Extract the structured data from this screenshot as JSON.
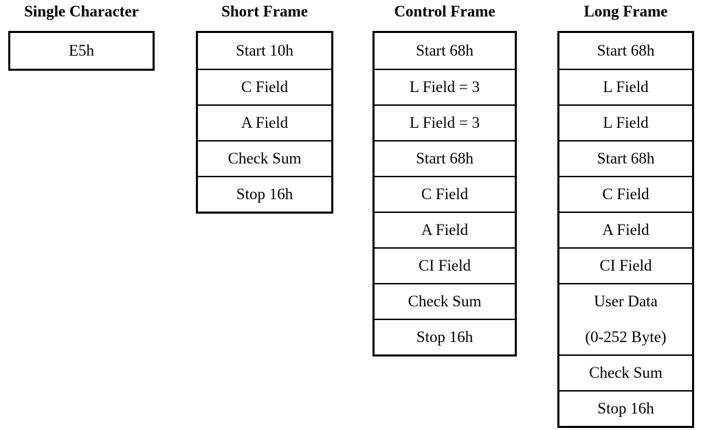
{
  "columns": [
    {
      "title": "Single Character",
      "rows": [
        [
          "E5h"
        ]
      ]
    },
    {
      "title": "Short Frame",
      "rows": [
        [
          "Start 10h"
        ],
        [
          "C Field"
        ],
        [
          "A Field"
        ],
        [
          "Check Sum"
        ],
        [
          "Stop 16h"
        ]
      ]
    },
    {
      "title": "Control Frame",
      "rows": [
        [
          "Start 68h"
        ],
        [
          "L Field = 3"
        ],
        [
          "L Field = 3"
        ],
        [
          "Start 68h"
        ],
        [
          "C Field"
        ],
        [
          "A Field"
        ],
        [
          "CI Field"
        ],
        [
          "Check Sum"
        ],
        [
          "Stop 16h"
        ]
      ]
    },
    {
      "title": "Long Frame",
      "rows": [
        [
          "Start 68h"
        ],
        [
          "L Field"
        ],
        [
          "L Field"
        ],
        [
          "Start 68h"
        ],
        [
          "C Field"
        ],
        [
          "A Field"
        ],
        [
          "CI Field"
        ],
        [
          "User Data",
          "(0-252 Byte)"
        ],
        [
          "Check Sum"
        ],
        [
          "Stop 16h"
        ]
      ]
    }
  ]
}
